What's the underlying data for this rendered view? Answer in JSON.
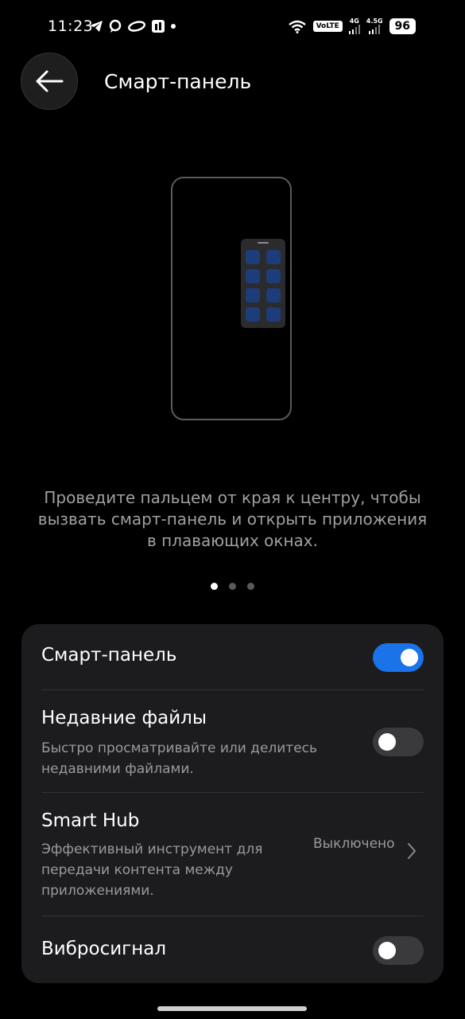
{
  "status_bar": {
    "time": "11:23",
    "left_icons": [
      "telegram-icon",
      "chat-icon",
      "cloud-icon",
      "app-icon",
      "notification-dot-icon"
    ],
    "volte": "VoLTE",
    "sim1_label": "4G",
    "sim2_label": "4.5G",
    "battery": "96"
  },
  "header": {
    "title": "Смарт-панель"
  },
  "illustration": {
    "accent_color": "#1d3c7a"
  },
  "description": {
    "text": "Проведите пальцем от края к центру, чтобы вызвать смарт-панель и открыть приложения в плавающих окнах."
  },
  "pager": {
    "count": 3,
    "active_index": 0
  },
  "settings": {
    "smart_panel": {
      "title": "Смарт-панель",
      "enabled": true
    },
    "recent_files": {
      "title": "Недавние файлы",
      "subtitle": "Быстро просматривайте или делитесь недавними файлами.",
      "enabled": false
    },
    "smart_hub": {
      "title": "Smart Hub",
      "subtitle": "Эффективный инструмент для передачи контента между приложениями.",
      "value": "Выключено"
    },
    "vibration": {
      "title": "Вибросигнал",
      "enabled": false
    }
  },
  "colors": {
    "background": "#000000",
    "card": "#1c1c1e",
    "toggle_on": "#1a73e8",
    "toggle_off": "#3a3a3c"
  }
}
